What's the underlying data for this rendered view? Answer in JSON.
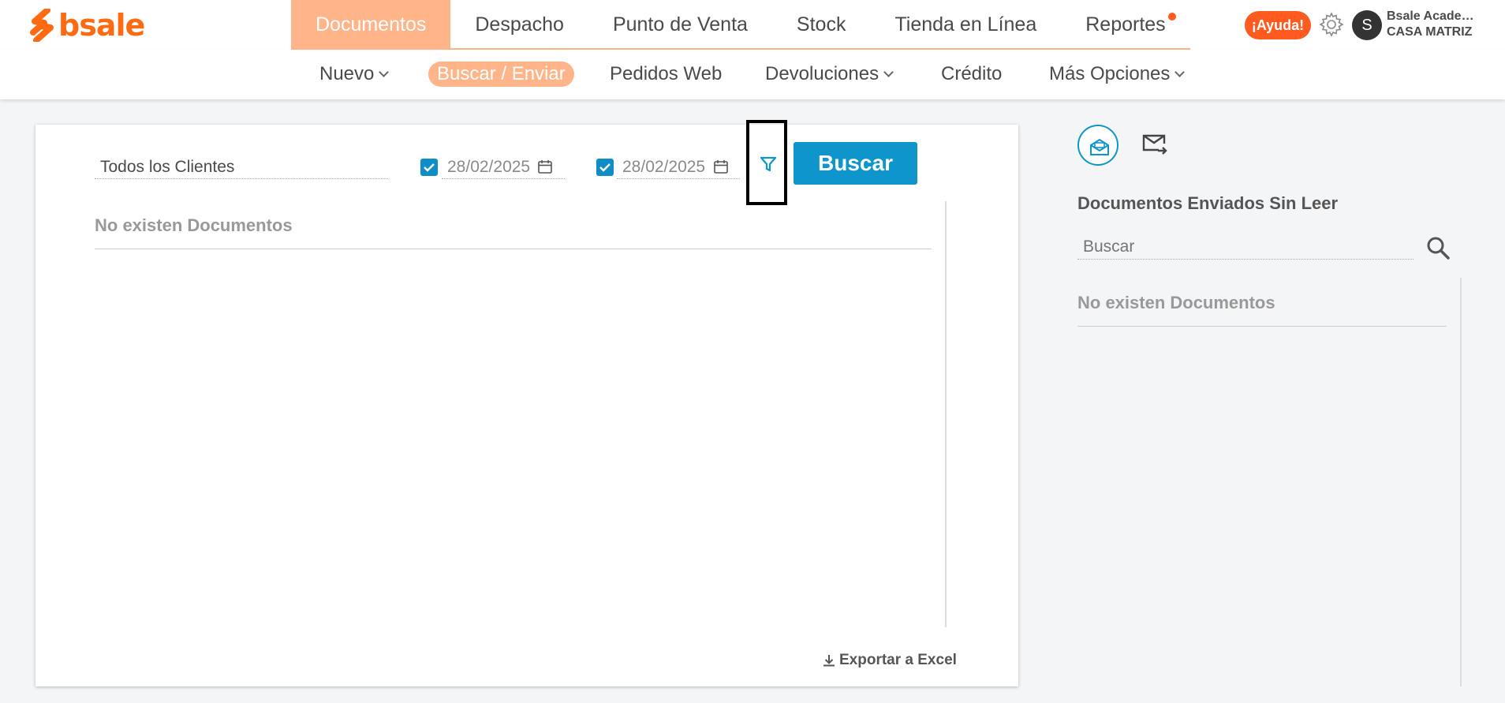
{
  "brand": {
    "name": "bsale",
    "color": "#ff6a13"
  },
  "main_nav": [
    {
      "label": "Documentos",
      "active": true
    },
    {
      "label": "Despacho",
      "active": false
    },
    {
      "label": "Punto de Venta",
      "active": false
    },
    {
      "label": "Stock",
      "active": false
    },
    {
      "label": "Tienda en Línea",
      "active": false
    },
    {
      "label": "Reportes",
      "active": false,
      "notification_dot": true
    }
  ],
  "header": {
    "help_label": "¡Ayuda!",
    "settings_icon": "gear-icon",
    "avatar_initial": "S",
    "user_name": "Bsale Academ...",
    "branch": "CASA MATRIZ"
  },
  "sub_nav": [
    {
      "label": "Nuevo",
      "dropdown": true
    },
    {
      "label": "Buscar / Enviar",
      "active": true
    },
    {
      "label": "Pedidos Web"
    },
    {
      "label": "Devoluciones",
      "dropdown": true
    },
    {
      "label": "Crédito"
    },
    {
      "label": "Más Opciones",
      "dropdown": true
    }
  ],
  "filters": {
    "client_value": "Todos los Clientes",
    "date_from": {
      "checked": true,
      "value": "28/02/2025"
    },
    "date_to": {
      "checked": true,
      "value": "28/02/2025"
    },
    "filter_icon": "filter-icon",
    "search_label": "Buscar"
  },
  "results": {
    "empty_message": "No existen Documentos",
    "export_label": "Exportar a Excel"
  },
  "side_panel": {
    "inbox_icon": "inbox-icon",
    "sent_icon": "mail-forward-icon",
    "title": "Documentos Enviados Sin Leer",
    "search_placeholder": "Buscar",
    "empty_message": "No existen Documentos"
  },
  "colors": {
    "accent_orange": "#ffb48a",
    "alert_orange": "#ff5a1f",
    "primary_blue": "#0e95cc"
  }
}
